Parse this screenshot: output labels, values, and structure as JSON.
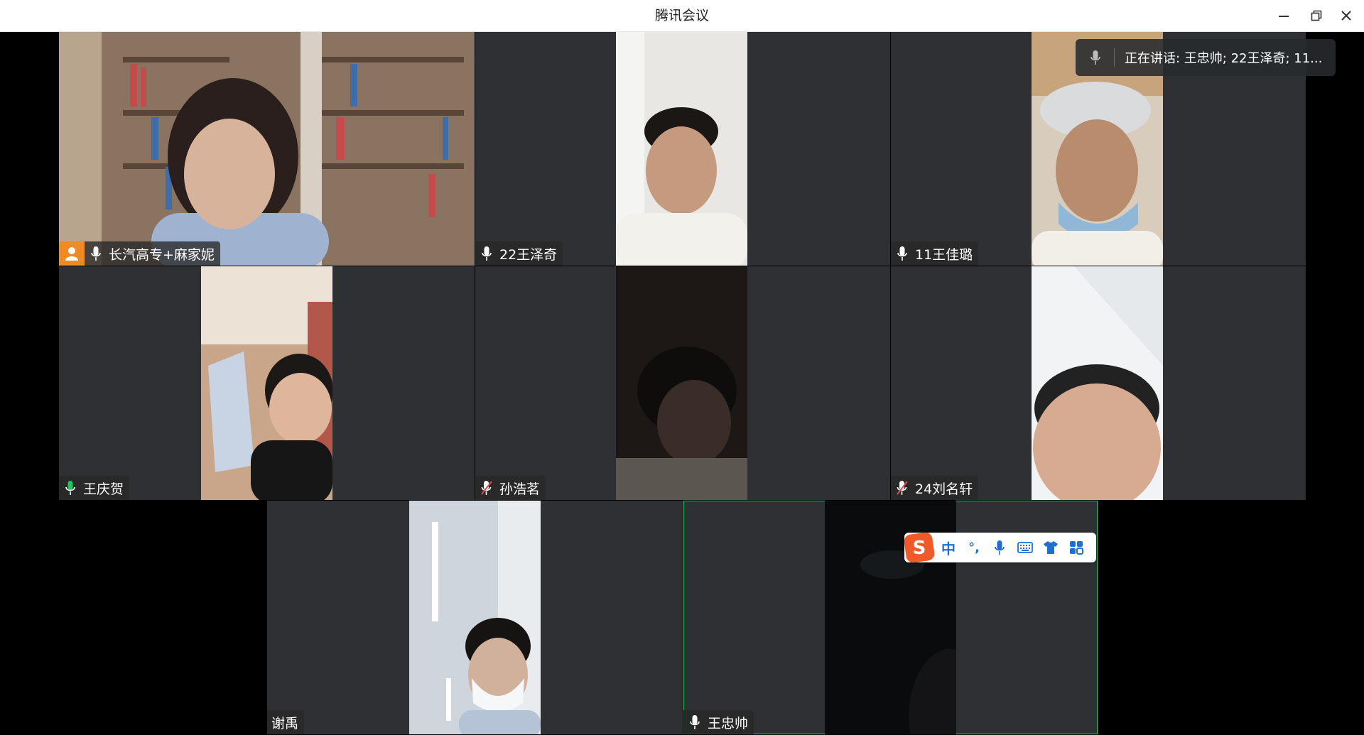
{
  "window": {
    "title": "腾讯会议"
  },
  "speaking": {
    "text": "正在讲话: 王忠帅; 22王泽奇; 11..."
  },
  "participants": [
    {
      "name": "长汽高专+麻家妮",
      "mic": "on",
      "host": true,
      "skin": "#d8b39c",
      "bg": "#b9a58e"
    },
    {
      "name": "22王泽奇",
      "mic": "on",
      "host": false,
      "skin": "#c69a7f",
      "bg": "#e8e7e3"
    },
    {
      "name": "11王佳璐",
      "mic": "on",
      "host": false,
      "skin": "#b98c6e",
      "bg": "#d8cdbd"
    },
    {
      "name": "王庆贺",
      "mic": "on-active",
      "host": false,
      "skin": "#ddb69b",
      "bg": "#c9a68a"
    },
    {
      "name": "孙浩茗",
      "mic": "muted",
      "host": false,
      "skin": "#3a2d27",
      "bg": "#1d1816"
    },
    {
      "name": "24刘名轩",
      "mic": "muted",
      "host": false,
      "skin": "#d7ab91",
      "bg": "#f1f3f4"
    },
    {
      "name": "谢禹",
      "mic": "none",
      "host": false,
      "skin": "#d1b19c",
      "bg": "#cfd5dc"
    },
    {
      "name": "王忠帅",
      "mic": "on",
      "host": false,
      "skin": "#141416",
      "bg": "#0a0b0c"
    }
  ],
  "ime": {
    "lang_label": "中",
    "punct_label": "°,",
    "brand": "S"
  },
  "colors": {
    "tile_bg": "#2e3033",
    "active_border": "#22c55e",
    "host_badge": "#f08a24",
    "mic_active": "#22c55e",
    "ime_blue": "#1f6fd1"
  }
}
